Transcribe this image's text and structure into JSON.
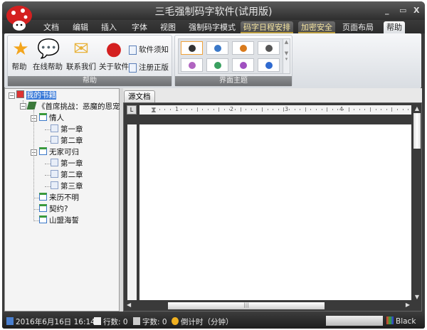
{
  "window": {
    "title": "三毛强制码字软件(试用版)",
    "controls": [
      "minimize",
      "maximize",
      "close"
    ]
  },
  "tabs": [
    {
      "label": "文档"
    },
    {
      "label": "编辑"
    },
    {
      "label": "插入"
    },
    {
      "label": "字体"
    },
    {
      "label": "视图"
    },
    {
      "label": "强制码字模式"
    },
    {
      "label": "码字日程安排"
    },
    {
      "label": "加密安全"
    },
    {
      "label": "页面布局"
    },
    {
      "label": "帮助",
      "active": true
    }
  ],
  "ribbon": {
    "help_group": {
      "label": "帮助",
      "buttons": [
        {
          "label": "帮助",
          "icon": "star-icon"
        },
        {
          "label": "在线帮助",
          "icon": "chat-bubbles-icon"
        },
        {
          "label": "联系我们",
          "icon": "envelope-icon"
        },
        {
          "label": "关于软件",
          "icon": "mushroom-icon"
        }
      ],
      "small_buttons": [
        {
          "label": "软件须知",
          "icon": "document-list-icon"
        },
        {
          "label": "注册正版",
          "icon": "register-icon"
        }
      ]
    },
    "theme_group": {
      "label": "界面主题",
      "themes": [
        {
          "color": "#333333"
        },
        {
          "color": "#3a78c8"
        },
        {
          "color": "#d97a1c"
        },
        {
          "color": "#555555"
        },
        {
          "color": "#b064c0"
        },
        {
          "color": "#3aa060"
        },
        {
          "color": "#a050c0"
        },
        {
          "color": "#2f6ad0"
        }
      ],
      "selected": 0
    }
  },
  "tree": {
    "root": "我的书籍",
    "book": "《首席挑战：恶魔的恩宠》",
    "volumes": [
      {
        "label": "情人",
        "chapters": [
          "第一章",
          "第二章"
        ]
      },
      {
        "label": "无家可归",
        "chapters": [
          "第一章",
          "第二章",
          "第三章"
        ]
      },
      {
        "label": "来历不明",
        "chapters": []
      },
      {
        "label": "契约?",
        "chapters": []
      },
      {
        "label": "山盟海誓",
        "chapters": []
      }
    ]
  },
  "editor": {
    "tab": "源文档",
    "ruler_labels": [
      "1",
      "2",
      "3",
      "4"
    ]
  },
  "status": {
    "datetime": "2016年6月16日 16:14",
    "lines": "行数: 0",
    "chars": "字数: 0",
    "countdown": "倒计时（分钟）",
    "theme": "Black"
  }
}
